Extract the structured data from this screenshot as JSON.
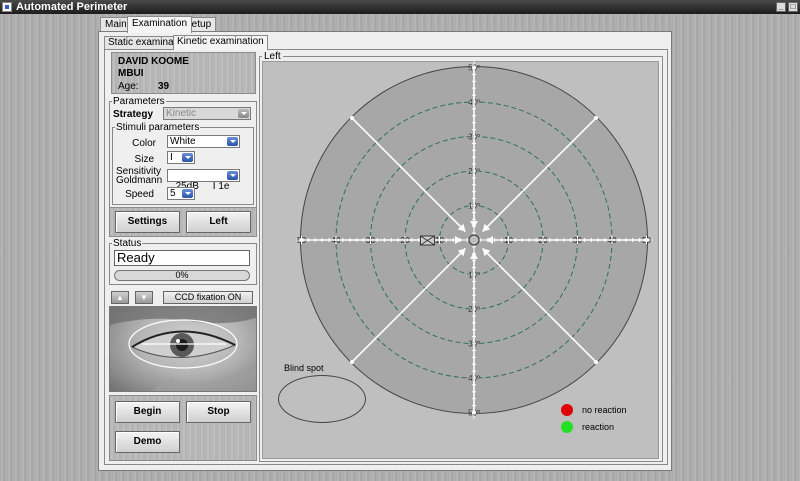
{
  "window": {
    "title": "Automated Perimeter",
    "controls": [
      "_",
      "□"
    ]
  },
  "tabs": {
    "main": "Main",
    "examination": "Examination",
    "setup": "Setup"
  },
  "subtabs": {
    "static": "Static examination",
    "kinetic": "Kinetic examination"
  },
  "patient": {
    "first_name": "DAVID KOOME",
    "last_name": "MBUI",
    "age_label": "Age:",
    "age_value": "39"
  },
  "parameters": {
    "group_label": "Parameters",
    "strategy_label": "Strategy",
    "strategy_value": "Kinetic",
    "stimuli_label": "Stimuli parameters",
    "color_label": "Color",
    "color_value": "White",
    "size_label": "Size",
    "size_value": "I",
    "sensitivity_label_1": "Sensitivity",
    "sensitivity_label_2": "Goldmann",
    "sensitivity_value": "25dB     I 1e",
    "speed_label": "Speed",
    "speed_value": "5"
  },
  "buttons": {
    "settings": "Settings",
    "eye_side": "Left",
    "begin": "Begin",
    "stop": "Stop",
    "demo": "Demo",
    "ccd": "CCD fixation ON",
    "up": "▲",
    "down": "▼"
  },
  "status": {
    "group_label": "Status",
    "value": "Ready",
    "progress_text": "0%",
    "progress_value": 0
  },
  "chart": {
    "frame_label": "Left",
    "blind_spot_label": "Blind spot",
    "radial_labels_deg": [
      10,
      20,
      30,
      40,
      50
    ],
    "degree_suffix": "º",
    "horizontal_labels": [
      "50",
      "40",
      "30",
      "20",
      "10",
      "10",
      "20",
      "30",
      "40",
      "50"
    ],
    "colors": {
      "background": "#bfbfbf",
      "ring": "#2f6f5f",
      "vector": "#ffffff",
      "no_reaction": "#e00000",
      "reaction": "#22e022"
    }
  },
  "legend": {
    "no_reaction": "no reaction",
    "reaction": "reaction"
  }
}
